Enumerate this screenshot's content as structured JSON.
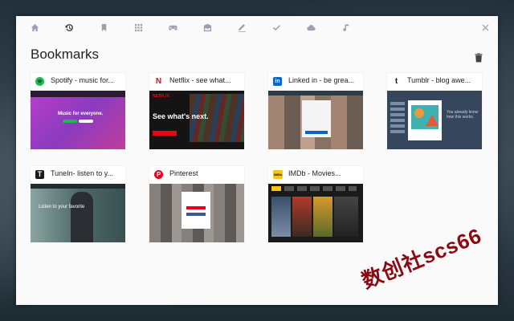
{
  "nav": {
    "items": [
      {
        "icon": "home-icon",
        "active": false
      },
      {
        "icon": "history-icon",
        "active": true
      },
      {
        "icon": "bookmark-icon",
        "active": false
      },
      {
        "icon": "apps-grid-icon",
        "active": false
      },
      {
        "icon": "gamepad-icon",
        "active": false
      },
      {
        "icon": "inbox-icon",
        "active": false
      },
      {
        "icon": "pencil-icon",
        "active": false
      },
      {
        "icon": "check-icon",
        "active": false
      },
      {
        "icon": "cloud-icon",
        "active": false
      },
      {
        "icon": "music-note-icon",
        "active": false
      }
    ],
    "close_icon": "close-icon"
  },
  "page": {
    "title": "Bookmarks",
    "delete_icon": "trash-icon"
  },
  "bookmarks": [
    {
      "title": "Spotify - music for...",
      "favicon": "S",
      "favicon_color": "#1db954"
    },
    {
      "title": "Netflix - see what...",
      "favicon": "N",
      "favicon_color": "#e50914"
    },
    {
      "title": "Linked in - be grea...",
      "favicon": "in",
      "favicon_color": "#0a66c2"
    },
    {
      "title": "Tumblr - blog awe...",
      "favicon": "t",
      "favicon_color": "#ffffff"
    },
    {
      "title": "TuneIn- listen to y...",
      "favicon": "T",
      "favicon_color": "#1c1c1c"
    },
    {
      "title": "Pinterest",
      "favicon": "P",
      "favicon_color": "#e60023"
    },
    {
      "title": "IMDb - Movies...",
      "favicon": "IMDb",
      "favicon_color": "#f5c518"
    }
  ],
  "thumbs": {
    "spotify_text": "Music for everyone.",
    "netflix_logo": "NETFLIX",
    "netflix_text": "See what's next.",
    "tumblr_text": "You already know how this works.",
    "tunein_text": "Listen to your favorite"
  },
  "watermark": "数创社scs66"
}
